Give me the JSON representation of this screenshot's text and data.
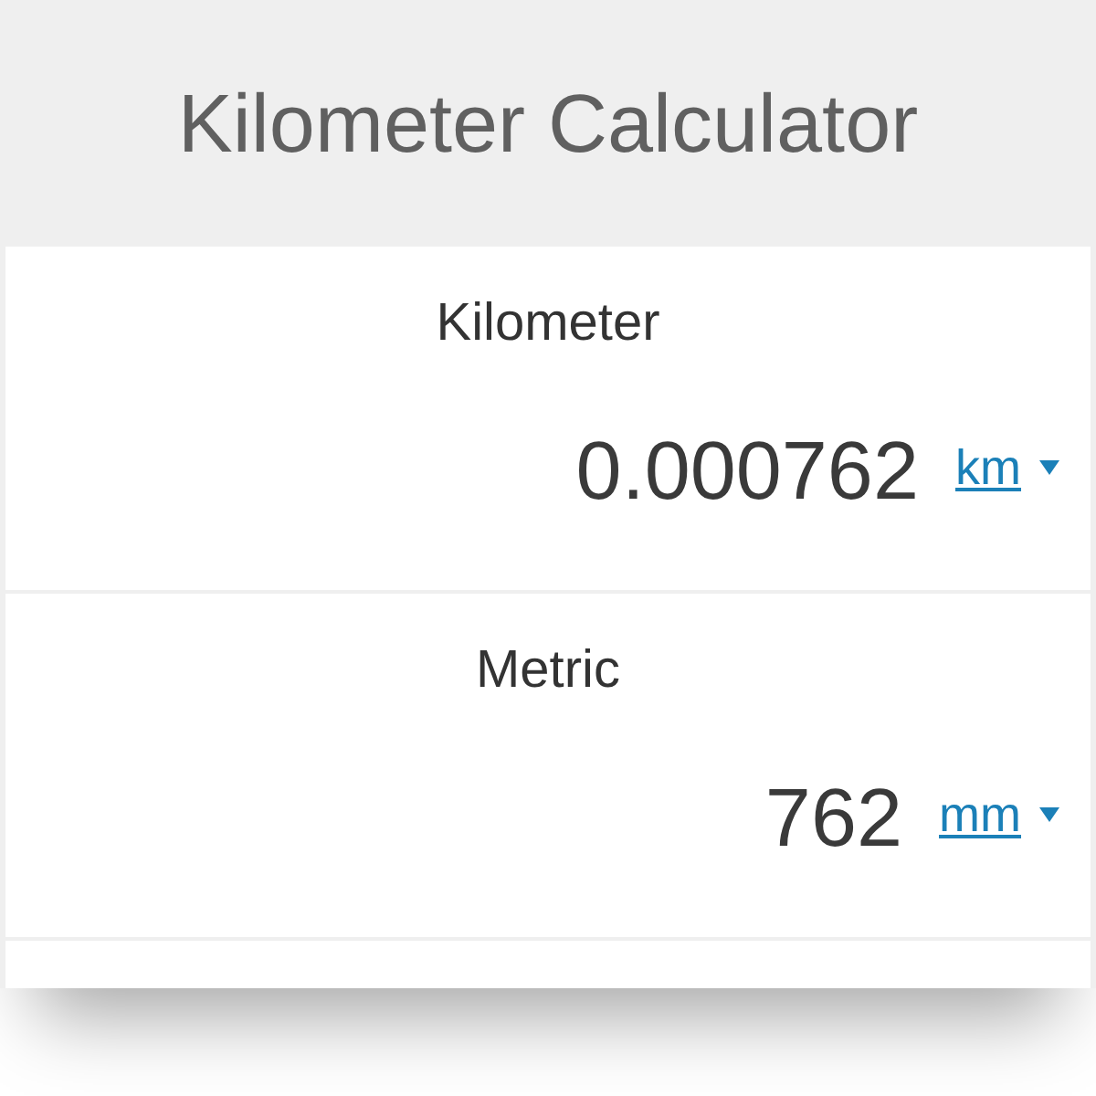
{
  "title": "Kilometer Calculator",
  "fields": [
    {
      "label": "Kilometer",
      "value": "0.000762",
      "unit": "km"
    },
    {
      "label": "Metric",
      "value": "762",
      "unit": "mm"
    }
  ]
}
